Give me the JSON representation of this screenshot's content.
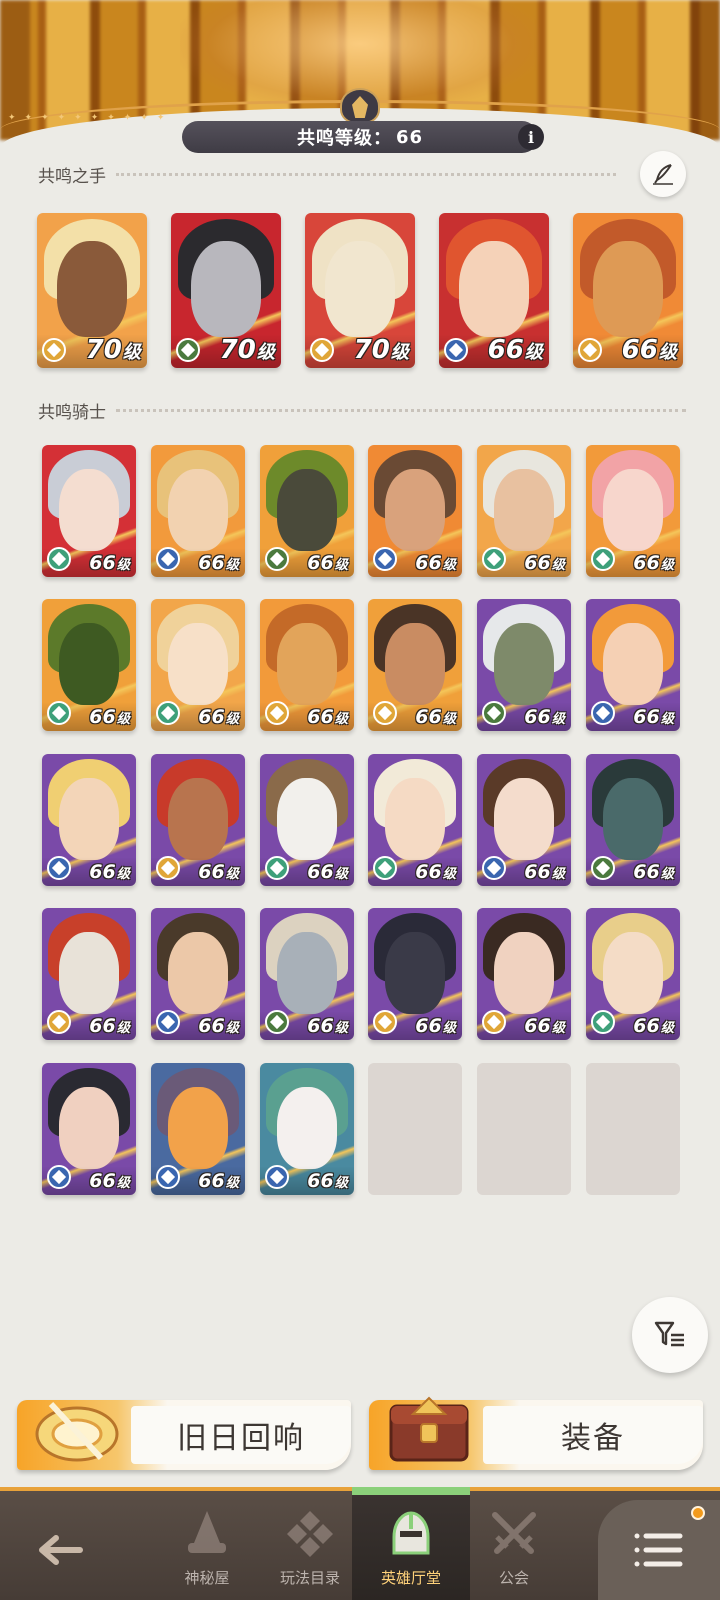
{
  "header": {
    "resonance_label": "共鸣等级：",
    "resonance_level": "66",
    "info_label": "i"
  },
  "hands_section": {
    "title": "共鸣之手",
    "heroes": [
      {
        "level": "70",
        "unit": "级",
        "bg": "#f2a24a",
        "hair": "#f3e0a8",
        "skin": "#8a5a3a",
        "faction": "#e0a638"
      },
      {
        "level": "70",
        "unit": "级",
        "bg": "#c8262e",
        "hair": "#2b2a2e",
        "skin": "#b8b7bd",
        "faction": "#4b7a3e"
      },
      {
        "level": "70",
        "unit": "级",
        "bg": "#d8463a",
        "hair": "#efe2c5",
        "skin": "#f1e6cf",
        "faction": "#e0a638"
      },
      {
        "level": "66",
        "unit": "级",
        "bg": "#c83030",
        "hair": "#e0552f",
        "skin": "#f5d2b8",
        "faction": "#3a66b0"
      },
      {
        "level": "66",
        "unit": "级",
        "bg": "#f08a36",
        "hair": "#c25a2a",
        "skin": "#de9a55",
        "faction": "#e0a638"
      }
    ]
  },
  "knights_section": {
    "title": "共鸣骑士",
    "heroes": [
      {
        "level": "66",
        "unit": "级",
        "bg": "#d43036",
        "hair": "#c9cdd6",
        "skin": "#f4ddd0",
        "faction": "#3ea07a"
      },
      {
        "level": "66",
        "unit": "级",
        "bg": "#f29a3c",
        "hair": "#e8c27a",
        "skin": "#f2d2b0",
        "faction": "#3a66b0"
      },
      {
        "level": "66",
        "unit": "级",
        "bg": "#f0a03a",
        "hair": "#6d8a2a",
        "skin": "#4a4a3a",
        "faction": "#4b7a3e"
      },
      {
        "level": "66",
        "unit": "级",
        "bg": "#f08a34",
        "hair": "#6a4a34",
        "skin": "#d9a27c",
        "faction": "#3a66b0"
      },
      {
        "level": "66",
        "unit": "级",
        "bg": "#f2a64a",
        "hair": "#e8e6de",
        "skin": "#e8c1a0",
        "faction": "#3ea07a"
      },
      {
        "level": "66",
        "unit": "级",
        "bg": "#f29a3a",
        "hair": "#f2a3a6",
        "skin": "#f7d6cc",
        "faction": "#3ea07a"
      },
      {
        "level": "66",
        "unit": "级",
        "bg": "#f0a03a",
        "hair": "#5c7a2a",
        "skin": "#3e5a22",
        "faction": "#3ea07a"
      },
      {
        "level": "66",
        "unit": "级",
        "bg": "#f2a64a",
        "hair": "#f0d29a",
        "skin": "#f7e0c8",
        "faction": "#3ea07a"
      },
      {
        "level": "66",
        "unit": "级",
        "bg": "#f29a3a",
        "hair": "#c46a28",
        "skin": "#e2a45a",
        "faction": "#e0a638"
      },
      {
        "level": "66",
        "unit": "级",
        "bg": "#f0a03a",
        "hair": "#4a3426",
        "skin": "#c98c62",
        "faction": "#e0a638"
      },
      {
        "level": "66",
        "unit": "级",
        "bg": "#7a4aa8",
        "hair": "#e6e8ea",
        "skin": "#7e8a6a",
        "faction": "#4b7a3e"
      },
      {
        "level": "66",
        "unit": "级",
        "bg": "#7a4aa8",
        "hair": "#f29a3a",
        "skin": "#f5d0b4",
        "faction": "#3a66b0"
      },
      {
        "level": "66",
        "unit": "级",
        "bg": "#7a4aa8",
        "hair": "#f0cf72",
        "skin": "#f3d5b8",
        "faction": "#3a66b0"
      },
      {
        "level": "66",
        "unit": "级",
        "bg": "#7a4aa8",
        "hair": "#c83a2a",
        "skin": "#b8744e",
        "faction": "#e0a638"
      },
      {
        "level": "66",
        "unit": "级",
        "bg": "#7a4aa8",
        "hair": "#8a6a4a",
        "skin": "#f2f0ec",
        "faction": "#3ea07a"
      },
      {
        "level": "66",
        "unit": "级",
        "bg": "#7a4aa8",
        "hair": "#f2ead8",
        "skin": "#f5dac4",
        "faction": "#3ea07a"
      },
      {
        "level": "66",
        "unit": "级",
        "bg": "#7a4aa8",
        "hair": "#5a3a28",
        "skin": "#f4dccc",
        "faction": "#3a66b0"
      },
      {
        "level": "66",
        "unit": "级",
        "bg": "#7a4aa8",
        "hair": "#2a3a3a",
        "skin": "#4a6a6a",
        "faction": "#4b7a3e"
      },
      {
        "level": "66",
        "unit": "级",
        "bg": "#7a4aa8",
        "hair": "#c8402a",
        "skin": "#e8e2d8",
        "faction": "#e0a638"
      },
      {
        "level": "66",
        "unit": "级",
        "bg": "#7a4aa8",
        "hair": "#4a3a2a",
        "skin": "#ecc8a8",
        "faction": "#3a66b0"
      },
      {
        "level": "66",
        "unit": "级",
        "bg": "#7a4aa8",
        "hair": "#dcd2c0",
        "skin": "#a8b0b8",
        "faction": "#4b7a3e"
      },
      {
        "level": "66",
        "unit": "级",
        "bg": "#7a4aa8",
        "hair": "#2a2a38",
        "skin": "#3a3a48",
        "faction": "#e0a638"
      },
      {
        "level": "66",
        "unit": "级",
        "bg": "#7a4aa8",
        "hair": "#3a2a22",
        "skin": "#f0d2c0",
        "faction": "#e0a638"
      },
      {
        "level": "66",
        "unit": "级",
        "bg": "#7a4aa8",
        "hair": "#e8ce8a",
        "skin": "#f4dcc6",
        "faction": "#3ea07a"
      },
      {
        "level": "66",
        "unit": "级",
        "bg": "#7a4aa8",
        "hair": "#2a2a32",
        "skin": "#f0d0c0",
        "faction": "#3a66b0"
      },
      {
        "level": "66",
        "unit": "级",
        "bg": "#4a6aa0",
        "hair": "#6a5a78",
        "skin": "#f2a24a",
        "faction": "#3a66b0"
      },
      {
        "level": "66",
        "unit": "级",
        "bg": "#4a8aa0",
        "hair": "#5aa090",
        "skin": "#f4f0ee",
        "faction": "#3a66b0"
      }
    ],
    "empty_slots": 3
  },
  "bottom_buttons": {
    "echo_label": "旧日回响",
    "equip_label": "装备"
  },
  "nav": {
    "items": [
      {
        "label": "神秘屋",
        "icon": "wizard-hat-icon"
      },
      {
        "label": "玩法目录",
        "icon": "diamond-grid-icon"
      },
      {
        "label": "英雄厅堂",
        "icon": "helmet-icon"
      },
      {
        "label": "公会",
        "icon": "crossed-swords-icon"
      }
    ],
    "accent": "#ffd27a"
  },
  "colors": {
    "background": "#ecebe6",
    "nav_border": "#e8a23a",
    "notification_dot": "#f29a1b"
  }
}
